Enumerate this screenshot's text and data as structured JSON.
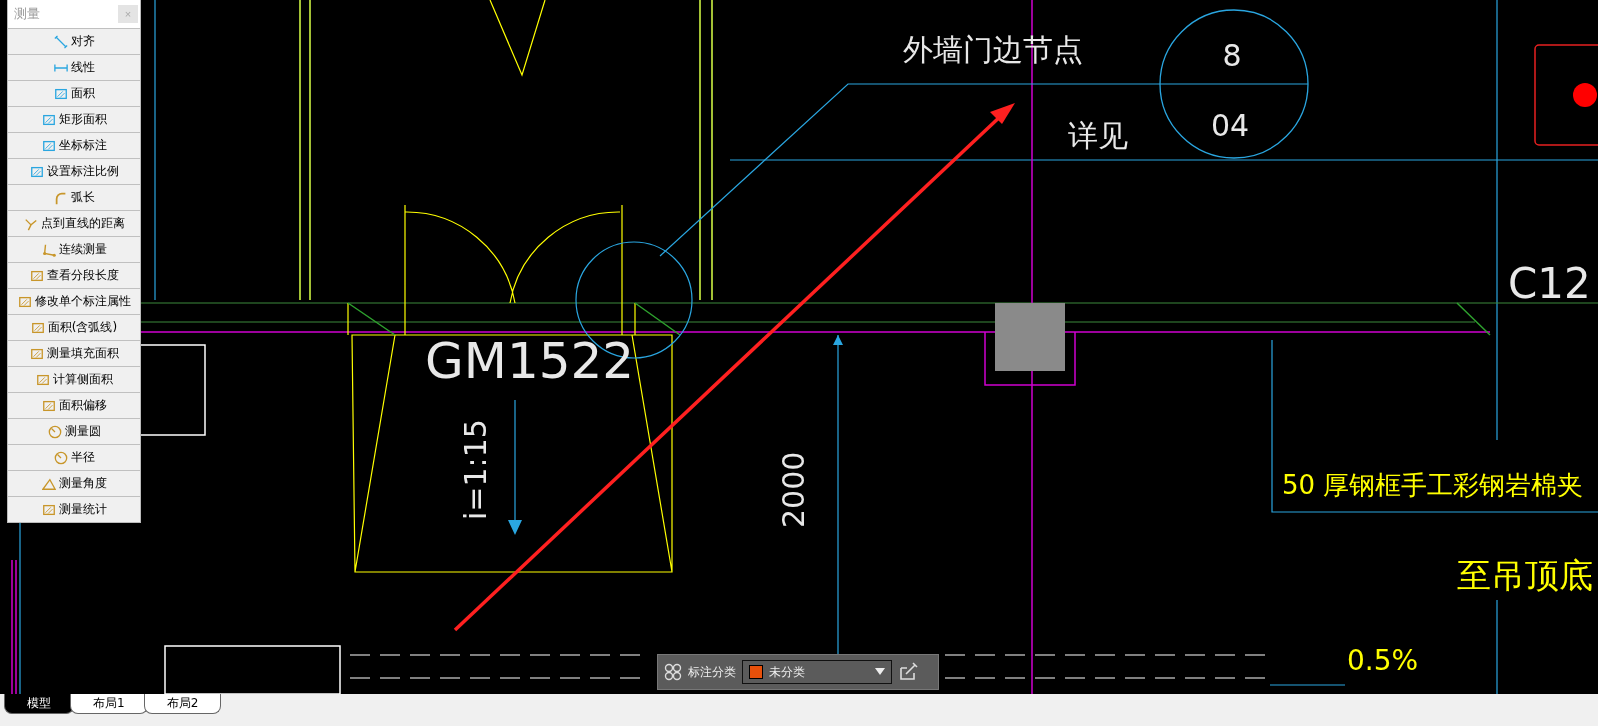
{
  "measure_panel": {
    "title": "测量",
    "close": "×",
    "items": [
      {
        "label": "对齐"
      },
      {
        "label": "线性"
      },
      {
        "label": "面积"
      },
      {
        "label": "矩形面积"
      },
      {
        "label": "坐标标注"
      },
      {
        "label": "设置标注比例"
      },
      {
        "label": "弧长"
      },
      {
        "label": "点到直线的距离"
      },
      {
        "label": "连续测量"
      },
      {
        "label": "查看分段长度"
      },
      {
        "label": "修改单个标注属性"
      },
      {
        "label": "面积(含弧线)"
      },
      {
        "label": "测量填充面积"
      },
      {
        "label": "计算侧面积"
      },
      {
        "label": "面积偏移"
      },
      {
        "label": "测量圆"
      },
      {
        "label": "半径"
      },
      {
        "label": "测量角度"
      },
      {
        "label": "测量统计"
      }
    ]
  },
  "drawing_texts": [
    {
      "kind": "label",
      "text": "外墙门边节点"
    },
    {
      "kind": "circle_top",
      "text": "8"
    },
    {
      "kind": "circle_bottom",
      "text": "04"
    },
    {
      "kind": "see",
      "text": "详见"
    },
    {
      "kind": "door",
      "text": "GM1522"
    },
    {
      "kind": "slope",
      "text": "i=1:15"
    },
    {
      "kind": "dimension",
      "text": "2000"
    },
    {
      "kind": "window",
      "text": "C12"
    },
    {
      "kind": "note",
      "text": "50  厚钢框手工彩钢岩棉夹"
    },
    {
      "kind": "note2",
      "text": "至吊顶底"
    },
    {
      "kind": "percent",
      "text": "0.5%"
    }
  ],
  "annotation_bar": {
    "label": "标注分类",
    "category": {
      "value": "未分类",
      "color": "#e8500a"
    }
  },
  "layout_tabs": [
    {
      "label": "模型",
      "selected": true
    },
    {
      "label": "布局1",
      "selected": false
    },
    {
      "label": "布局2",
      "selected": false
    }
  ]
}
